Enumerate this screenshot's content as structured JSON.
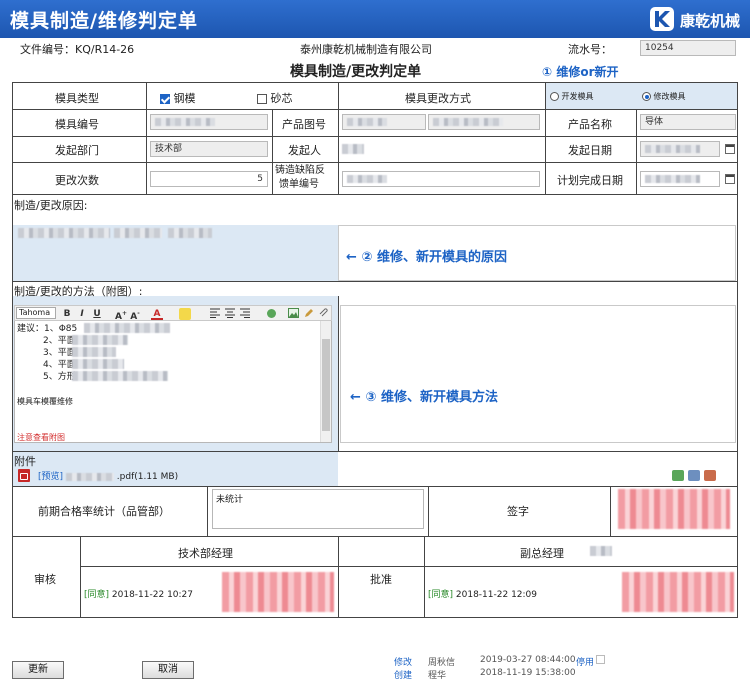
{
  "header": {
    "title": "模具制造/维修判定单",
    "logo_text": "康乾机械"
  },
  "doc_info": {
    "file_no_label": "文件编号：KQ/R14-26",
    "company": "泰州康乾机械制造有限公司",
    "serial_label": "流水号：",
    "serial_value": "10254",
    "form_title": "模具制造/更改判定单"
  },
  "annotations": {
    "a1": "① 维修or新开",
    "a2": "← ② 维修、新开模具的原因",
    "a3": "← ③ 维修、新开模具方法"
  },
  "row1": {
    "mold_type_label": "模具类型",
    "opt_steel": "钢模",
    "opt_sand": "砂芯",
    "change_method_label": "模具更改方式",
    "opt_new": "开发模具",
    "opt_modify": "修改模具"
  },
  "row2": {
    "mold_no_label": "模具编号",
    "mold_no_value": "",
    "product_drawing_label": "产品图号",
    "product_name_label": "产品名称",
    "product_name_value": "导体"
  },
  "row3": {
    "dept_label": "发起部门",
    "dept_value": "技术部",
    "initiator_label": "发起人",
    "date_label": "发起日期"
  },
  "row4": {
    "change_count_label": "更改次数",
    "change_count_value": "5",
    "feedback_label_1": "铸造缺陷反",
    "feedback_label_2": "馈单编号",
    "plan_date_label": "计划完成日期"
  },
  "reason": {
    "label": "制造/更改原因:"
  },
  "method": {
    "label": "制造/更改的方法（附图）:",
    "font_name": "Tahoma",
    "lines": [
      "建议：1、Φ85",
      "2、平面",
      "3、平面",
      "4、平面",
      "5、方形"
    ],
    "note": "模具车模覆维修",
    "red_note": "注意查看附图"
  },
  "attachment": {
    "label": "附件",
    "file_prefix": "[预览]",
    "file_suffix": ".pdf(1.11 MB)"
  },
  "stats": {
    "label": "前期合格率统计（品管部）",
    "value": "未统计",
    "sign_label": "签字"
  },
  "approval": {
    "review_label": "审核",
    "tech_manager_label": "技术部经理",
    "tech_status": "[同意]",
    "tech_time": "2018-11-22 10:27",
    "approve_label": "批准",
    "vp_label": "副总经理",
    "vp_status": "[同意]",
    "vp_time": "2018-11-22 12:09"
  },
  "footer": {
    "update_button": "更新",
    "cancel_button": "取消",
    "modify_label": "修改",
    "modify_user": "周秋信",
    "modify_time": "2019-03-27 08:44:00",
    "disable_label": "停用",
    "create_label": "创建",
    "create_user": "程华",
    "create_time": "2018-11-19 15:38:00"
  },
  "colors": {
    "header_blue": "#1d56b0",
    "annotation_blue": "#1d63c5",
    "highlight_bg": "#dce8f4",
    "approve_green": "#2a8a2a",
    "warning_red": "#d32f2f"
  }
}
